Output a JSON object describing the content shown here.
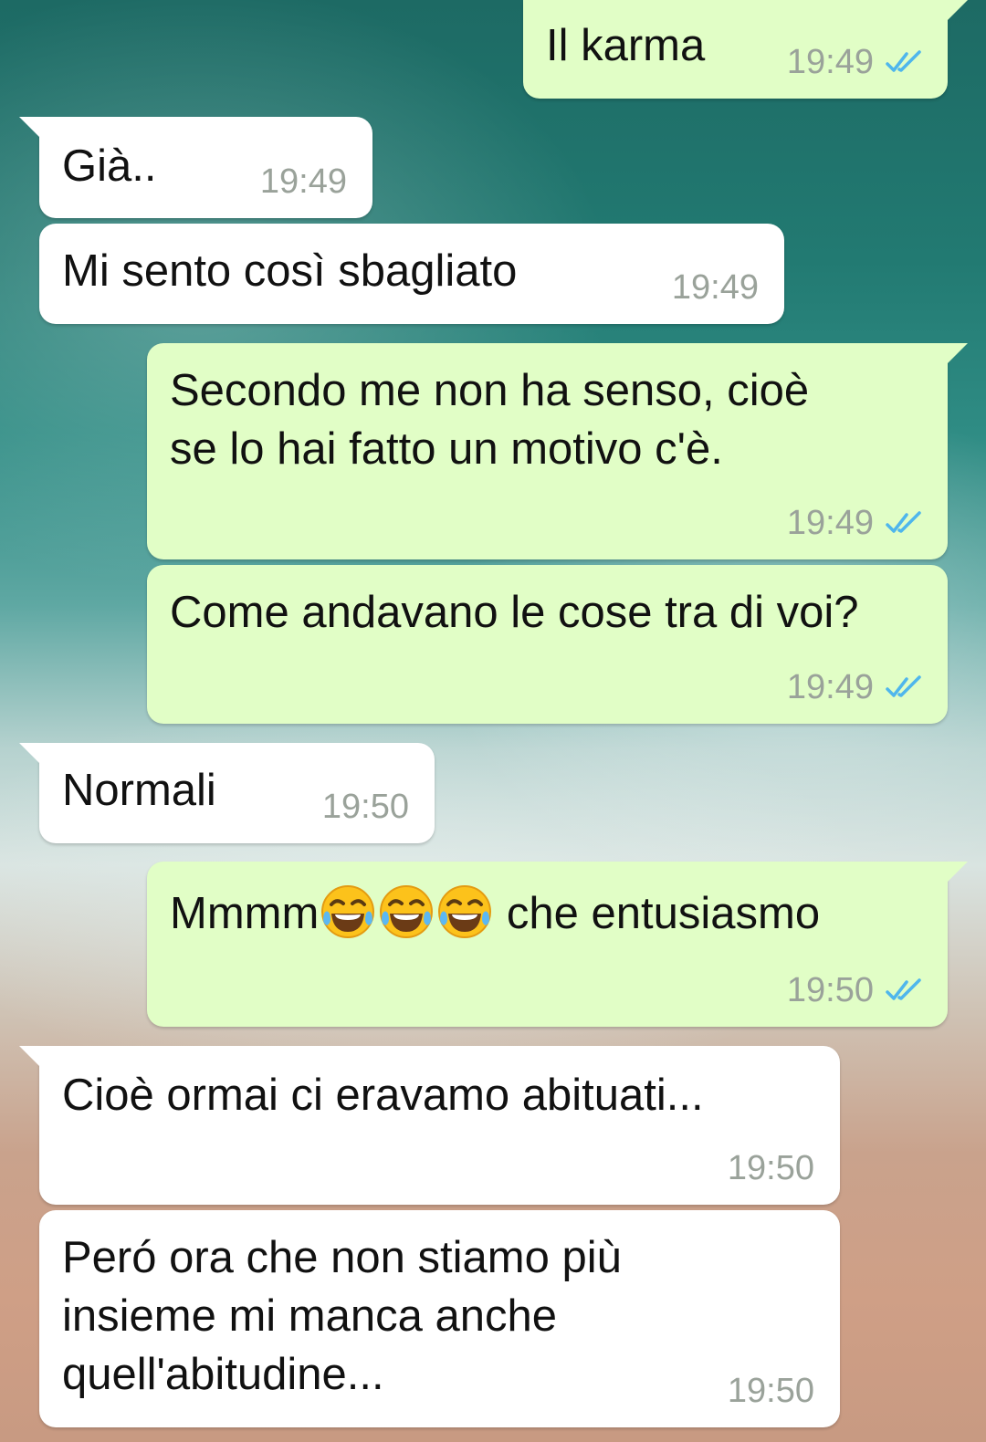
{
  "messages": [
    {
      "dir": "out",
      "text": "Il karma",
      "time": "19:49",
      "read": true
    },
    {
      "dir": "in",
      "text": "Già..",
      "time": "19:49"
    },
    {
      "dir": "in",
      "text": "Mi sento così sbagliato",
      "time": "19:49"
    },
    {
      "dir": "out",
      "text": "Secondo me non ha senso, cioè\nse lo hai fatto un motivo c'è.",
      "time": "19:49",
      "read": true
    },
    {
      "dir": "out",
      "text": "Come andavano le cose tra di voi?",
      "time": "19:49",
      "read": true
    },
    {
      "dir": "in",
      "text": "Normali",
      "time": "19:50"
    },
    {
      "dir": "out",
      "text_prefix": "Mmmm",
      "emoji": "face-with-tears-of-joy",
      "emoji_count": 3,
      "text_suffix": " che entusiasmo",
      "time": "19:50",
      "read": true
    },
    {
      "dir": "in",
      "text": "Cioè ormai ci eravamo abituati...",
      "time": "19:50"
    },
    {
      "dir": "in",
      "text": "Peró ora che non stiamo più\ninsieme mi manca anche\nquell'abitudine...",
      "time": "19:50"
    }
  ],
  "colors": {
    "outgoing_bubble": "#e1fec6",
    "incoming_bubble": "#ffffff",
    "read_ticks": "#4fb6ec",
    "timestamp": "#9aa29a"
  }
}
